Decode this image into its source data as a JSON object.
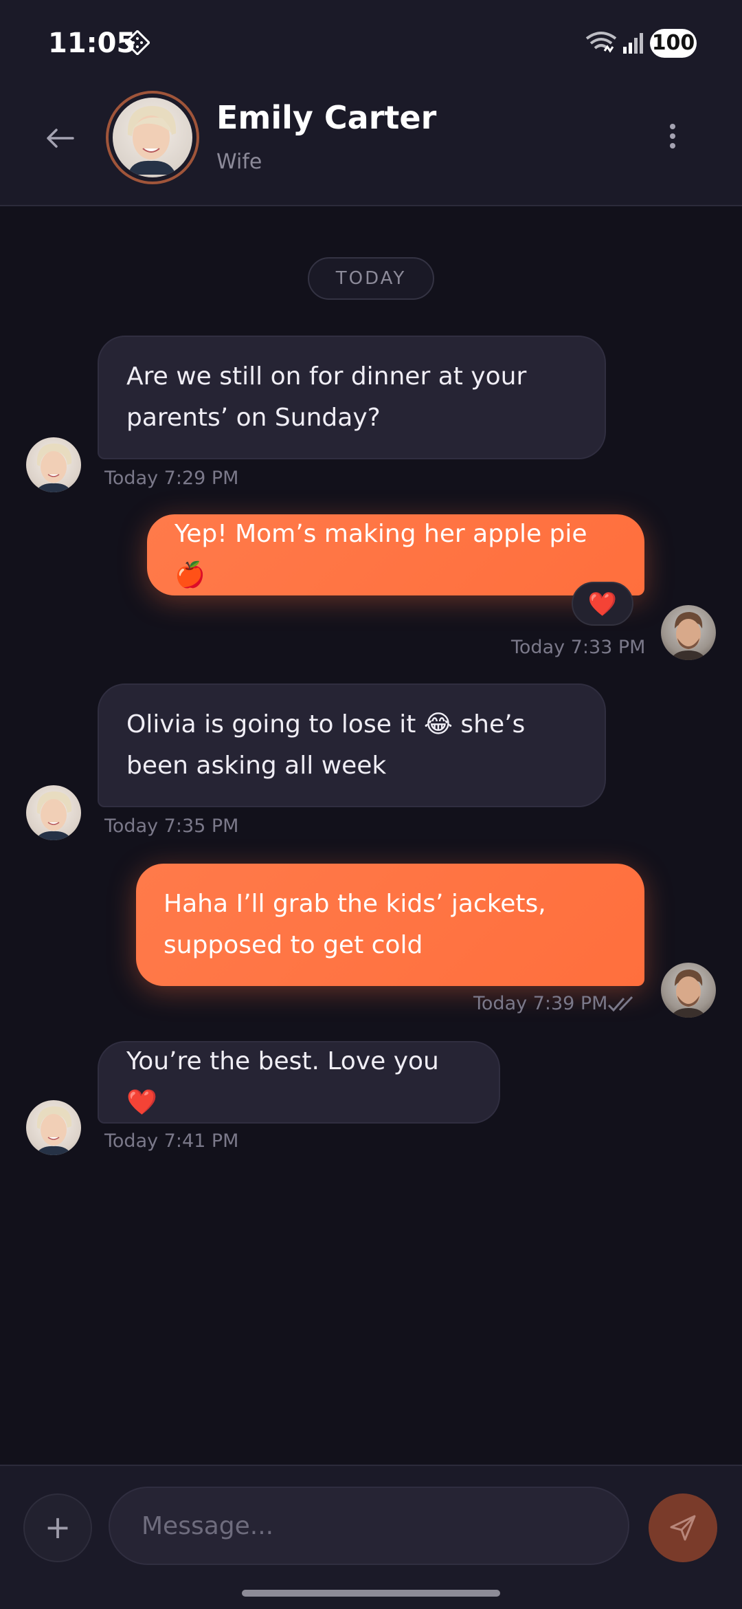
{
  "status_bar": {
    "time": "11:05",
    "battery": "100"
  },
  "header": {
    "contact_name": "Emily Carter",
    "relationship": "Wife"
  },
  "date_divider": "TODAY",
  "messages": [
    {
      "direction": "incoming",
      "text": "Are we still on for dinner at your parents’ on Sunday?",
      "time": "Today 7:29 PM"
    },
    {
      "direction": "outgoing",
      "text": "Yep! Mom’s making her apple pie 🍎",
      "time": "Today 7:33 PM",
      "reaction": "❤️"
    },
    {
      "direction": "incoming",
      "text": "Olivia is going to lose it 😂 she’s been asking all week",
      "time": "Today 7:35 PM"
    },
    {
      "direction": "outgoing",
      "text": "Haha I’ll grab the kids’ jackets, supposed to get cold",
      "time": "Today 7:39 PM",
      "status": "read"
    },
    {
      "direction": "incoming",
      "text": "You’re the best. Love you ❤️",
      "time": "Today 7:41 PM"
    }
  ],
  "composer": {
    "placeholder": "Message...",
    "plus_label": "+"
  },
  "colors": {
    "accent": "#ff7a4a",
    "background": "#12111b",
    "incoming_bubble": "#262434",
    "header": "#1b1a28"
  },
  "icons": {
    "back": "arrow-left-icon",
    "more": "more-vertical-icon",
    "send": "send-icon",
    "add": "plus-icon"
  }
}
